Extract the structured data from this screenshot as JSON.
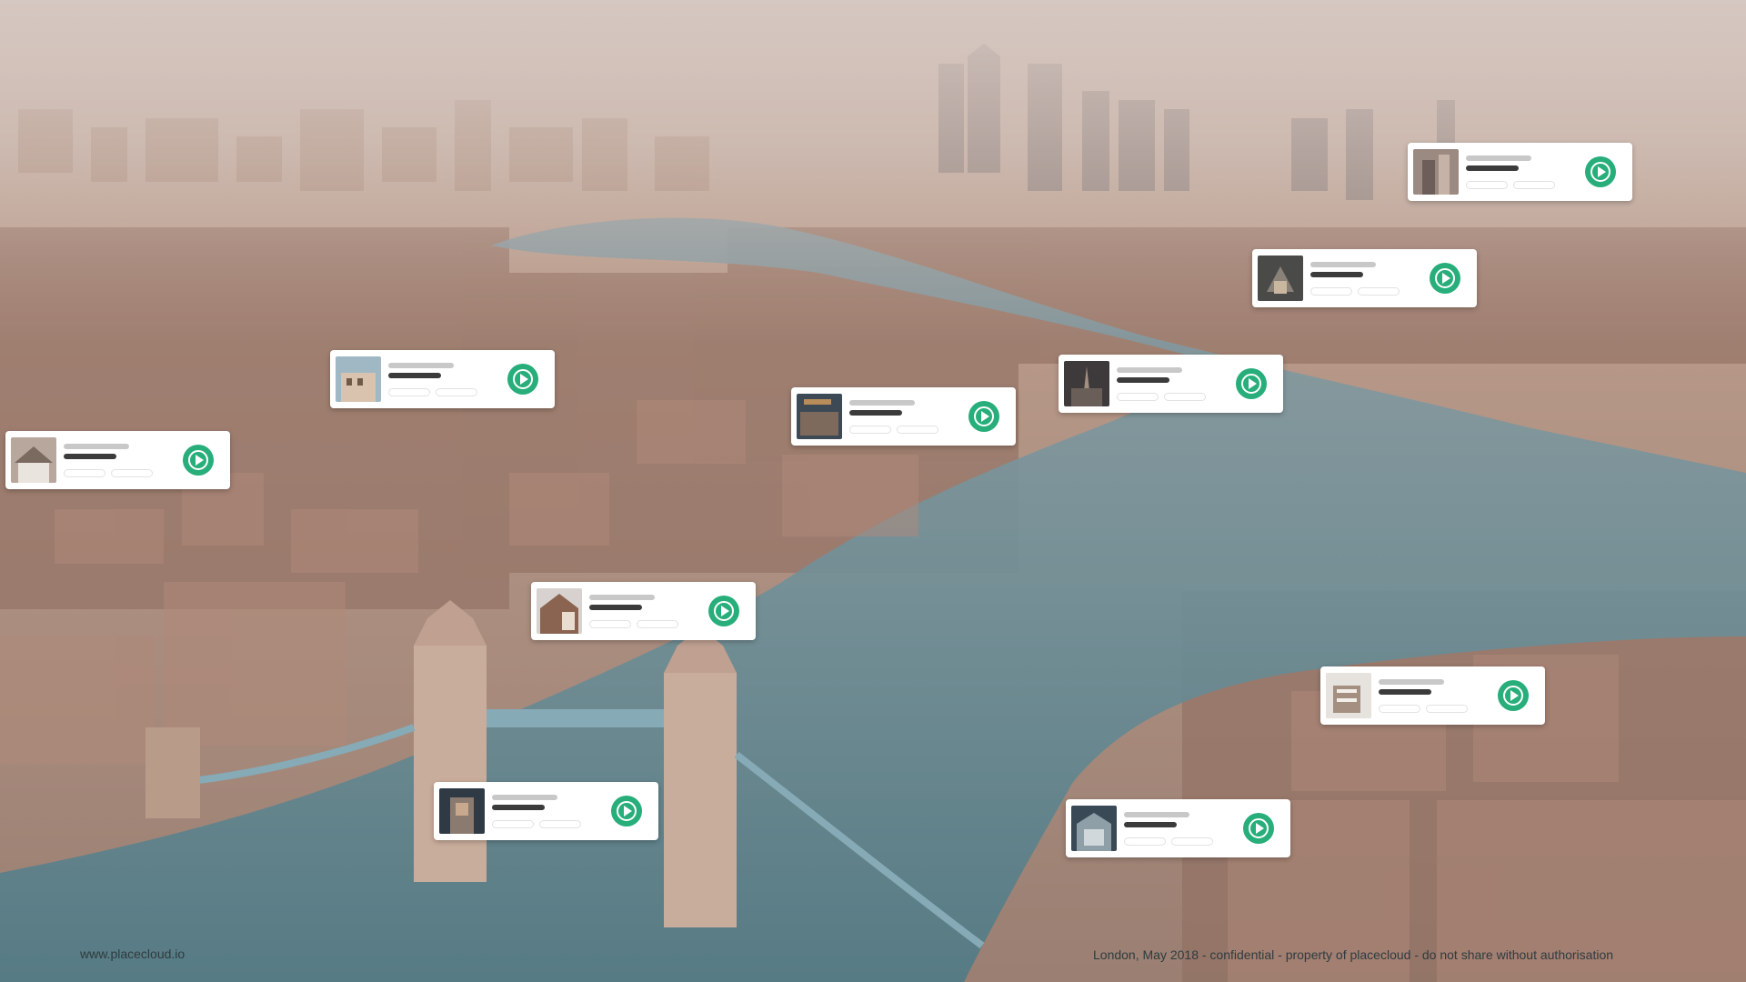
{
  "footer": {
    "site": "www.placecloud.io",
    "notice": "London, May 2018 - confidential - property of placecloud - do not share without authorisation"
  },
  "colors": {
    "accent": "#27ae7a",
    "card_bg": "#ffffff",
    "text_dark": "#2f3b3f",
    "river": "#6f8f98",
    "sky_haze": "#cdbcb4"
  },
  "icons": {
    "play": "play-circle-icon"
  },
  "cards": [
    {
      "name": "place-card-canary-wharf"
    },
    {
      "name": "place-card-greenwich"
    },
    {
      "name": "place-card-shad-thames"
    },
    {
      "name": "place-card-wapping"
    },
    {
      "name": "place-card-rotherhithe"
    },
    {
      "name": "place-card-st-katharine"
    },
    {
      "name": "place-card-butlers-wharf"
    },
    {
      "name": "place-card-tower-bridge"
    },
    {
      "name": "place-card-tower-hill"
    },
    {
      "name": "place-card-bermondsey"
    }
  ]
}
